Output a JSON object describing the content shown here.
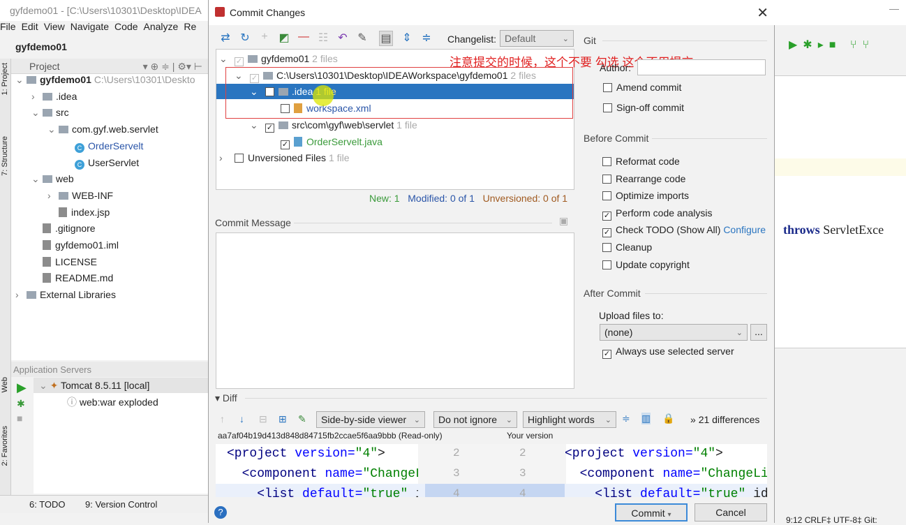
{
  "ide": {
    "title": "gyfdemo01 - [C:\\Users\\10301\\Desktop\\IDEA",
    "menu": [
      "File",
      "Edit",
      "View",
      "Navigate",
      "Code",
      "Analyze",
      "Re"
    ],
    "breadcrumb": "gyfdemo01",
    "project_header": "Project",
    "side_tabs": [
      "1: Project",
      "7: Structure",
      "Web",
      "2: Favorites"
    ],
    "tree": [
      {
        "label": "gyfdemo01",
        "extra": "C:\\Users\\10301\\Deskto",
        "type": "module",
        "depth": 0,
        "expanded": true
      },
      {
        "label": ".idea",
        "type": "folder",
        "depth": 1,
        "expanded": false
      },
      {
        "label": "src",
        "type": "folder",
        "depth": 1,
        "expanded": true
      },
      {
        "label": "com.gyf.web.servlet",
        "type": "package",
        "depth": 2,
        "expanded": true
      },
      {
        "label": "OrderServelt",
        "type": "class",
        "depth": 3,
        "modified": true
      },
      {
        "label": "UserServlet",
        "type": "class",
        "depth": 3
      },
      {
        "label": "web",
        "type": "folder",
        "depth": 1,
        "expanded": true
      },
      {
        "label": "WEB-INF",
        "type": "folder",
        "depth": 2,
        "expanded": false
      },
      {
        "label": "index.jsp",
        "type": "file",
        "depth": 2
      },
      {
        "label": ".gitignore",
        "type": "file",
        "depth": 1
      },
      {
        "label": "gyfdemo01.iml",
        "type": "file",
        "depth": 1
      },
      {
        "label": "LICENSE",
        "type": "file",
        "depth": 1
      },
      {
        "label": "README.md",
        "type": "file",
        "depth": 1
      },
      {
        "label": "External Libraries",
        "type": "lib",
        "depth": 0,
        "expanded": false
      }
    ],
    "app_servers": {
      "title": "Application Servers",
      "server": "Tomcat 8.5.11 [local]",
      "artifact": "web:war exploded"
    },
    "bottom_tabs": [
      "6: TODO",
      "9: Version Control"
    ],
    "code_fragment": {
      "keyword": "throws",
      "text": "ServletExce"
    },
    "status": "9:12  CRLF‡  UTF-8‡  Git:"
  },
  "dialog": {
    "title": "Commit Changes",
    "changelist_label": "Changelist:",
    "changelist_value": "Default",
    "annotation": "注意提交的时候，这个不要  勾选  这个不用提交",
    "changes": [
      {
        "label": "gyfdemo01",
        "count": "2 files",
        "checked": true,
        "disabled": true,
        "depth": 0
      },
      {
        "label": "C:\\Users\\10301\\Desktop\\IDEAWorkspace\\gyfdemo01",
        "count": "2 files",
        "checked": true,
        "disabled": true,
        "depth": 1
      },
      {
        "label": ".idea",
        "count": "1 file",
        "checked": false,
        "selected": true,
        "depth": 2
      },
      {
        "label": "workspace.xml",
        "count": "",
        "checked": false,
        "depth": 3,
        "color": "#2a55a8"
      },
      {
        "label": "src\\com\\gyf\\web\\servlet",
        "count": "1 file",
        "checked": true,
        "depth": 2
      },
      {
        "label": "OrderServelt.java",
        "count": "",
        "checked": true,
        "depth": 3,
        "color": "#3a9a3a"
      },
      {
        "label": "Unversioned Files",
        "count": "1 file",
        "checked": false,
        "depth": 0,
        "collapsed": true
      }
    ],
    "summary": {
      "new": "New: 1",
      "modified": "Modified: 0 of 1",
      "unversioned": "Unversioned: 0 of 1"
    },
    "commit_message_label": "Commit Message",
    "git": {
      "section": "Git",
      "author_label": "Author:",
      "author_value": "",
      "amend": {
        "label": "Amend commit",
        "checked": false
      },
      "signoff": {
        "label": "Sign-off commit",
        "checked": false
      }
    },
    "before_commit": {
      "section": "Before Commit",
      "options": [
        {
          "label": "Reformat code",
          "checked": false
        },
        {
          "label": "Rearrange code",
          "checked": false
        },
        {
          "label": "Optimize imports",
          "checked": false
        },
        {
          "label": "Perform code analysis",
          "checked": true
        },
        {
          "label": "Check TODO (Show All)",
          "checked": true,
          "link": "Configure"
        },
        {
          "label": "Cleanup",
          "checked": false
        },
        {
          "label": "Update copyright",
          "checked": false
        }
      ]
    },
    "after_commit": {
      "section": "After Commit",
      "upload_label": "Upload files to:",
      "upload_value": "(none)",
      "browse": "...",
      "always_use": {
        "label": "Always use selected server",
        "checked": true
      }
    },
    "diff": {
      "section": "Diff",
      "viewer": "Side-by-side viewer",
      "ignore": "Do not ignore",
      "highlight": "Highlight words",
      "differences": "21 differences",
      "left_title": "aa7af04b19d413d848d84715fb2ccae5f6aa9bbb (Read-only)",
      "right_title": "Your version",
      "lines": [
        {
          "num": "2",
          "indent": "",
          "tag": "<project",
          "attr": " version=",
          "val": "\"4\"",
          "end": ">",
          "right_val": "\"4\"",
          "right_end": ">"
        },
        {
          "num": "3",
          "indent": "  ",
          "tag": "<component",
          "attr": " name=",
          "val": "\"ChangeL:",
          "end": "",
          "right_val": "\"ChangeLis",
          "right_end": ""
        },
        {
          "num": "4",
          "indent": "    ",
          "tag": "<list",
          "attr": " default=",
          "val": "\"true\"",
          "end": " i(",
          "right_val": "\"true\"",
          "right_end": " id="
        }
      ]
    },
    "buttons": {
      "commit": "Commit",
      "cancel": "Cancel",
      "help": "?"
    }
  }
}
